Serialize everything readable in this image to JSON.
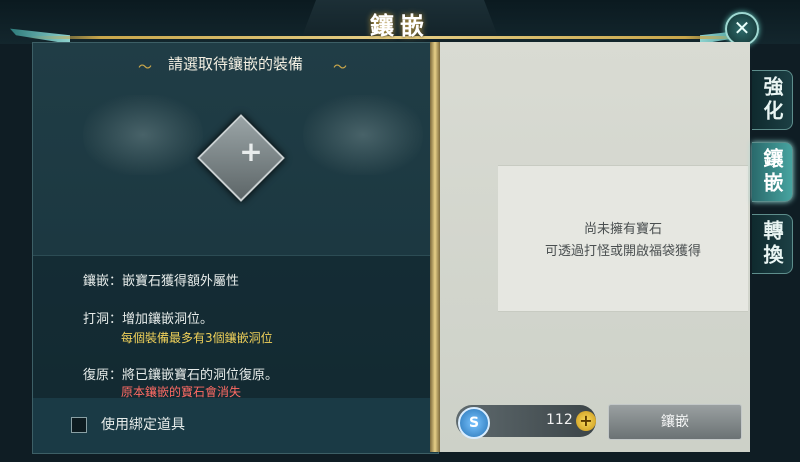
{
  "header": {
    "title": "鑲嵌"
  },
  "close": {
    "icon": "close-icon",
    "glyph": "✕"
  },
  "left_panel": {
    "select_prompt": "請選取待鑲嵌的裝備",
    "slot_glyph": "+",
    "info": {
      "embed": "鑲嵌：嵌寶石獲得額外屬性",
      "punch": "打洞：增加鑲嵌洞位。",
      "punch_note": "每個裝備最多有3個鑲嵌洞位",
      "restore": "復原：將已鑲嵌寶石的洞位復原。",
      "restore_warning": "原本鑲嵌的寶石會消失"
    },
    "use_bound_items": {
      "label": "使用綁定道具",
      "checked": false
    }
  },
  "right_panel": {
    "empty_line1": "尚未擁有寶石",
    "empty_line2": "可透過打怪或開啟福袋獲得",
    "currency": {
      "icon_letter": "S",
      "value": "112",
      "add_glyph": "+"
    },
    "embed_button": "鑲嵌"
  },
  "tabs": [
    {
      "label": "強化",
      "active": false
    },
    {
      "label": "鑲嵌",
      "active": true
    },
    {
      "label": "轉換",
      "active": false
    }
  ],
  "colors": {
    "accent_gold": "#c9a64b",
    "note_yellow": "#f0d15a",
    "warning_red": "#ff6b64"
  }
}
